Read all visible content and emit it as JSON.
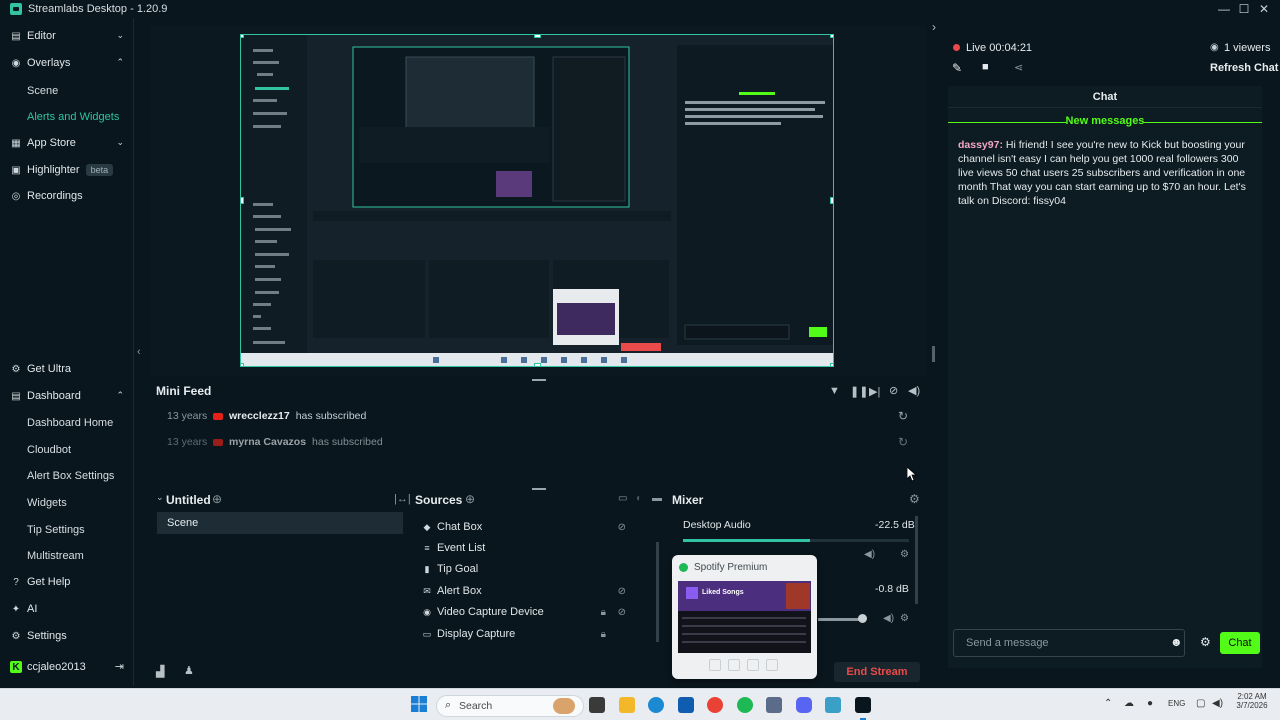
{
  "window": {
    "title": "Streamlabs Desktop - 1.20.9",
    "controls": [
      "—",
      "☐",
      "✕"
    ]
  },
  "sidebar": {
    "editor": "Editor",
    "overlays": "Overlays",
    "scene": "Scene",
    "alerts_widgets": "Alerts and Widgets",
    "app_store": "App Store",
    "highlighter": "Highlighter",
    "highlighter_badge": "beta",
    "recordings": "Recordings",
    "get_ultra": "Get Ultra",
    "dashboard": "Dashboard",
    "dashboard_home": "Dashboard Home",
    "cloudbot": "Cloudbot",
    "alert_box_settings": "Alert Box Settings",
    "widgets": "Widgets",
    "tip_settings": "Tip Settings",
    "multistream": "Multistream",
    "get_help": "Get Help",
    "ai": "AI",
    "settings": "Settings",
    "username": "ccjaleo2013"
  },
  "mini_feed": {
    "title": "Mini Feed",
    "events": [
      {
        "age": "13 years",
        "user": "wrecclezz17",
        "action": "has subscribed"
      },
      {
        "age": "13 years",
        "user": "myrna Cavazos",
        "action": "has subscribed"
      }
    ]
  },
  "scenes": {
    "title": "Untitled",
    "items": [
      "Scene"
    ]
  },
  "sources": {
    "title": "Sources",
    "items": [
      {
        "name": "Chat Box",
        "icon": "chat-icon"
      },
      {
        "name": "Event List",
        "icon": "list-icon"
      },
      {
        "name": "Tip Goal",
        "icon": "goal-icon"
      },
      {
        "name": "Alert Box",
        "icon": "alert-icon"
      },
      {
        "name": "Video Capture Device",
        "icon": "camera-icon"
      },
      {
        "name": "Display Capture",
        "icon": "monitor-icon"
      }
    ]
  },
  "mixer": {
    "title": "Mixer",
    "channels": [
      {
        "name": "Desktop Audio",
        "level": "-22.5 dB"
      },
      {
        "name": "",
        "level": "-0.8 dB"
      }
    ]
  },
  "stream": {
    "end_label": "End Stream"
  },
  "live": {
    "status": "Live 00:04:21",
    "viewers": "1 viewers",
    "refresh": "Refresh Chat"
  },
  "chat": {
    "title": "Chat",
    "new_messages": "New messages",
    "messages": [
      {
        "user": "dassy97:",
        "text": "Hi friend! I see you're new to Kick but boosting your channel isn't easy I can help you get 1000 real followers 300 live views 50 chat users 25 subscribers and verification in one month That way you can start earning up to $70 an hour. Let's talk on Discord: fissy04"
      }
    ],
    "input_placeholder": "Send a message",
    "send_label": "Chat"
  },
  "spotify": {
    "title": "Spotify Premium",
    "playlist": "Liked Songs"
  },
  "taskbar": {
    "search": "Search",
    "lang": "ENG",
    "time": "2:02 AM",
    "date": "3/7/2026"
  },
  "colors": {
    "accent": "#31c3a2",
    "live": "#eb4a4a",
    "chat_green": "#53fc18",
    "end_stream": "#eb4a4a"
  }
}
